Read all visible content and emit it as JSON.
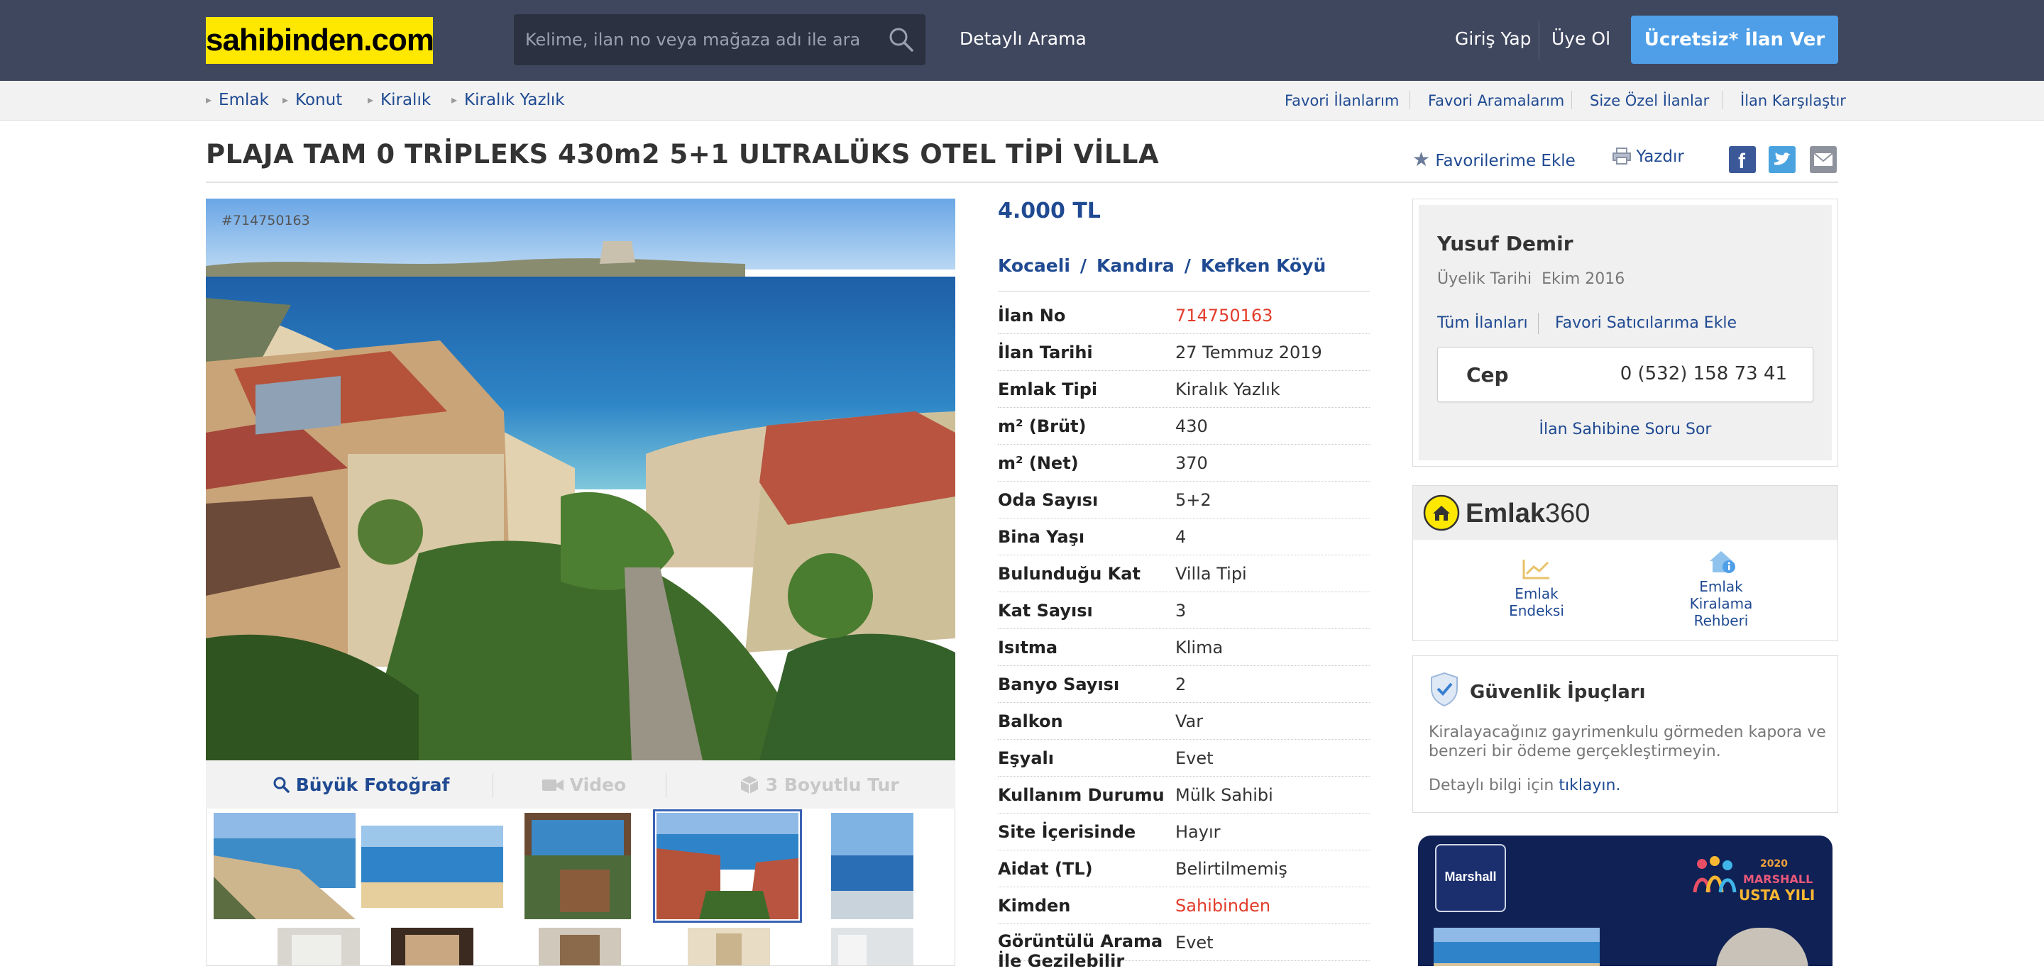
{
  "header": {
    "logo": "sahibinden.com",
    "search_placeholder": "Kelime, ilan no veya mağaza adı ile ara",
    "advanced_search": "Detaylı Arama",
    "login": "Giriş Yap",
    "register": "Üye Ol",
    "post_ad": "Ücretsiz* İlan Ver"
  },
  "breadcrumb": [
    "Emlak",
    "Konut",
    "Kiralık",
    "Kiralık Yazlık"
  ],
  "subnav_links": [
    "Favori İlanlarım",
    "Favori Aramalarım",
    "Size Özel İlanlar",
    "İlan Karşılaştır"
  ],
  "listing": {
    "title": "PLAJA TAM 0 TRİPLEKS 430m2 5+1 ULTRALÜKS OTEL TİPİ VİLLA",
    "add_favorite": "Favorilerime Ekle",
    "print": "Yazdır",
    "photo_id": "#714750163",
    "photo_bar": {
      "big_photo": "Büyük Fotoğraf",
      "video": "Video",
      "tour": "3 Boyutlu Tur"
    },
    "price": "4.000 TL",
    "location": [
      "Kocaeli",
      "Kandıra",
      "Kefken Köyü"
    ],
    "location_sep": "/",
    "details": [
      {
        "label": "İlan No",
        "value": "714750163",
        "highlight": true
      },
      {
        "label": "İlan Tarihi",
        "value": "27 Temmuz 2019"
      },
      {
        "label": "Emlak Tipi",
        "value": "Kiralık Yazlık"
      },
      {
        "label": "m² (Brüt)",
        "value": "430"
      },
      {
        "label": "m² (Net)",
        "value": "370"
      },
      {
        "label": "Oda Sayısı",
        "value": "5+2"
      },
      {
        "label": "Bina Yaşı",
        "value": "4"
      },
      {
        "label": "Bulunduğu Kat",
        "value": "Villa Tipi"
      },
      {
        "label": "Kat Sayısı",
        "value": "3"
      },
      {
        "label": "Isıtma",
        "value": "Klima"
      },
      {
        "label": "Banyo Sayısı",
        "value": "2"
      },
      {
        "label": "Balkon",
        "value": "Var"
      },
      {
        "label": "Eşyalı",
        "value": "Evet"
      },
      {
        "label": "Kullanım Durumu",
        "value": "Mülk Sahibi"
      },
      {
        "label": "Site İçerisinde",
        "value": "Hayır"
      },
      {
        "label": "Aidat (TL)",
        "value": "Belirtilmemiş"
      },
      {
        "label": "Kimden",
        "value": "Sahibinden",
        "highlight": true
      },
      {
        "label": "Görüntülü Arama İle Gezilebilir",
        "value": "Evet"
      }
    ]
  },
  "seller": {
    "name": "Yusuf Demir",
    "member_label": "Üyelik Tarihi",
    "member_since": "Ekim 2016",
    "all_listings": "Tüm İlanları",
    "add_fav_seller": "Favori Satıcılarıma Ekle",
    "phone_label": "Cep",
    "phone": "0 (532) 158 73 41",
    "ask_owner": "İlan Sahibine Soru Sor"
  },
  "emlak360": {
    "title_bold": "Emlak",
    "title_light": "360",
    "items": [
      {
        "line1": "Emlak",
        "line2": "Endeksi",
        "line3": ""
      },
      {
        "line1": "Emlak",
        "line2": "Kiralama",
        "line3": "Rehberi"
      }
    ]
  },
  "safety": {
    "title": "Güvenlik İpuçları",
    "text": "Kiralayacağınız gayrimenkulu görmeden kapora ve benzeri bir ödeme gerçekleştirmeyin.",
    "more_prefix": "Detaylı bilgi için",
    "more_link": "tıklayın."
  },
  "ad": {
    "brand": "Marshall",
    "tagline_year": "2020",
    "tagline": "MARSHALL",
    "tagline2": "USTA YILI"
  },
  "colors": {
    "header_bg": "#3f475f",
    "logo_bg": "#ffe800",
    "cta_bg": "#4f9fe8",
    "link": "#1f4a92",
    "highlight": "#e23c2a"
  }
}
